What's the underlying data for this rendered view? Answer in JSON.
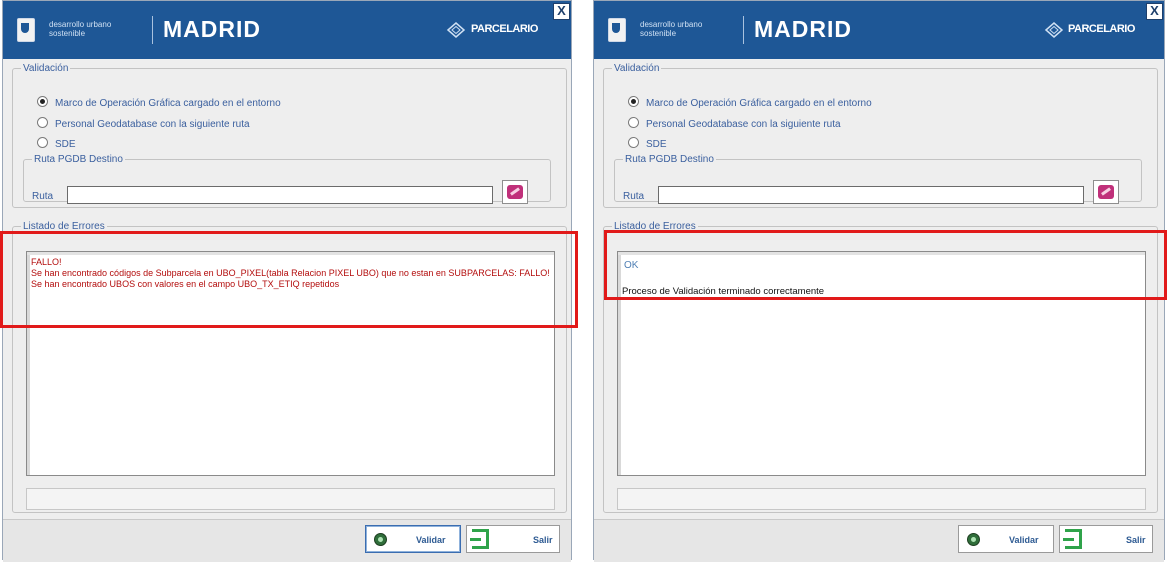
{
  "colors": {
    "header_bg": "#1e5796",
    "highlight": "#e11a1a",
    "error_text": "#b30d0d",
    "ok_text": "#4f7fb4",
    "label_text": "#3a5f9e"
  },
  "icons": {
    "crest": "madrid-crest-icon",
    "parcelario": "parcelario-logo-icon",
    "close": "close-icon",
    "ruta": "folder-picker-icon",
    "validar": "validate-icon",
    "salir": "exit-icon"
  },
  "windows": [
    {
      "header": {
        "brand_sub": "desarrollo urbano sostenible",
        "brand": "MADRID",
        "product": "PARCELARIO",
        "close": "X"
      },
      "validation": {
        "legend": "Validación",
        "options": [
          {
            "label": "Marco de Operación Gráfica cargado en el entorno",
            "selected": true
          },
          {
            "label": "Personal Geodatabase con la siguiente ruta",
            "selected": false
          },
          {
            "label": "SDE",
            "selected": false
          }
        ],
        "ruta_legend": "Ruta PGDB Destino",
        "ruta_label": "Ruta",
        "ruta_value": ""
      },
      "errors": {
        "legend": "Listado de Errores",
        "text": "FALLO!\nSe han encontrado códigos de Subparcela en UBO_PIXEL(tabla Relacion PIXEL UBO) que no estan en SUBPARCELAS:  FALLO!\nSe han encontrado UBOS con valores en el campo UBO_TX_ETIQ repetidos"
      },
      "footer": {
        "validar": "Validar",
        "salir": "Salir"
      }
    },
    {
      "header": {
        "brand_sub": "desarrollo urbano sostenible",
        "brand": "MADRID",
        "product": "PARCELARIO",
        "close": "X"
      },
      "validation": {
        "legend": "Validación",
        "options": [
          {
            "label": "Marco de Operación Gráfica cargado en el entorno",
            "selected": true
          },
          {
            "label": "Personal Geodatabase con la siguiente ruta",
            "selected": false
          },
          {
            "label": "SDE",
            "selected": false
          }
        ],
        "ruta_legend": "Ruta PGDB Destino",
        "ruta_label": "Ruta",
        "ruta_value": ""
      },
      "errors": {
        "legend": "Listado de Errores",
        "ok": "OK",
        "text": "Proceso de Validación terminado correctamente"
      },
      "footer": {
        "validar": "Validar",
        "salir": "Salir"
      }
    }
  ]
}
